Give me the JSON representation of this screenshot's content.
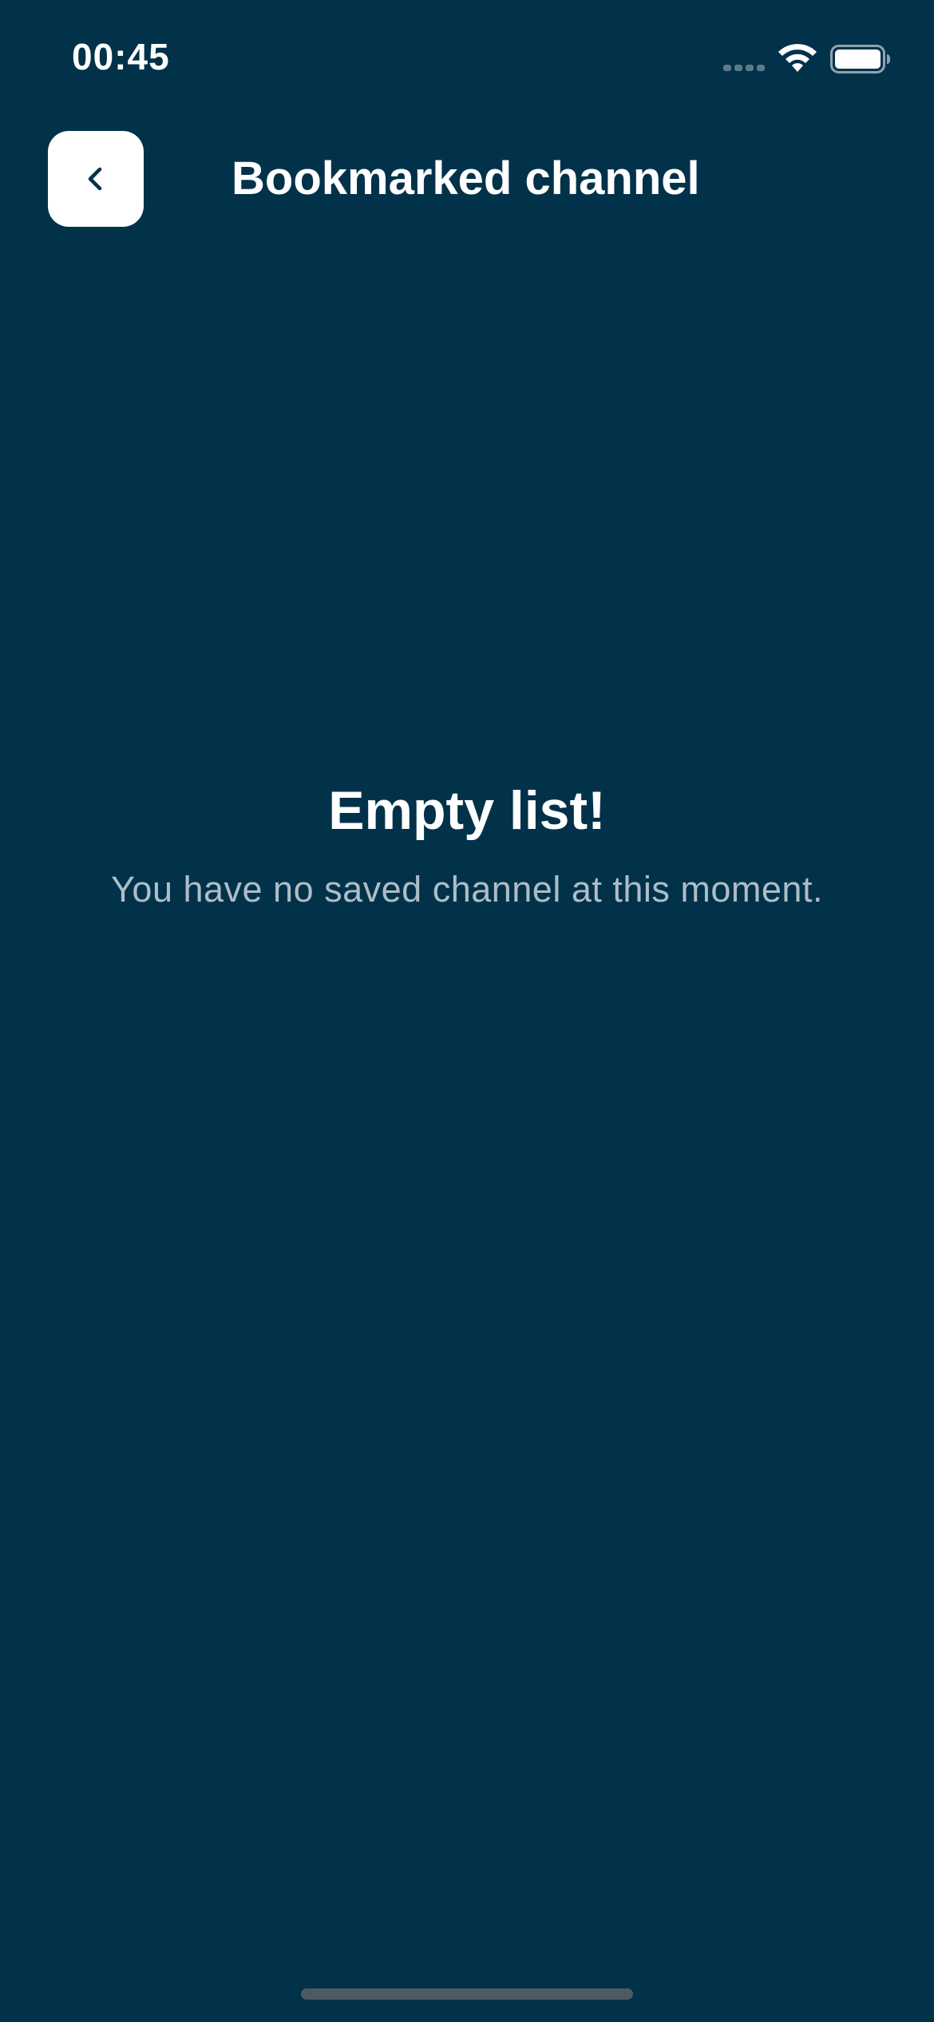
{
  "status_bar": {
    "time": "00:45",
    "icons": [
      "cellular-signal-icon",
      "wifi-icon",
      "battery-icon"
    ]
  },
  "header": {
    "back_icon": "chevron-left-icon",
    "title": "Bookmarked channel"
  },
  "empty_state": {
    "title": "Empty list!",
    "message": "You have no saved channel at this moment."
  },
  "colors": {
    "background": "#02324a",
    "text_primary": "#ffffff",
    "text_secondary": "#aebdc6",
    "button_background": "#ffffff",
    "icon_dark": "#02324a"
  }
}
